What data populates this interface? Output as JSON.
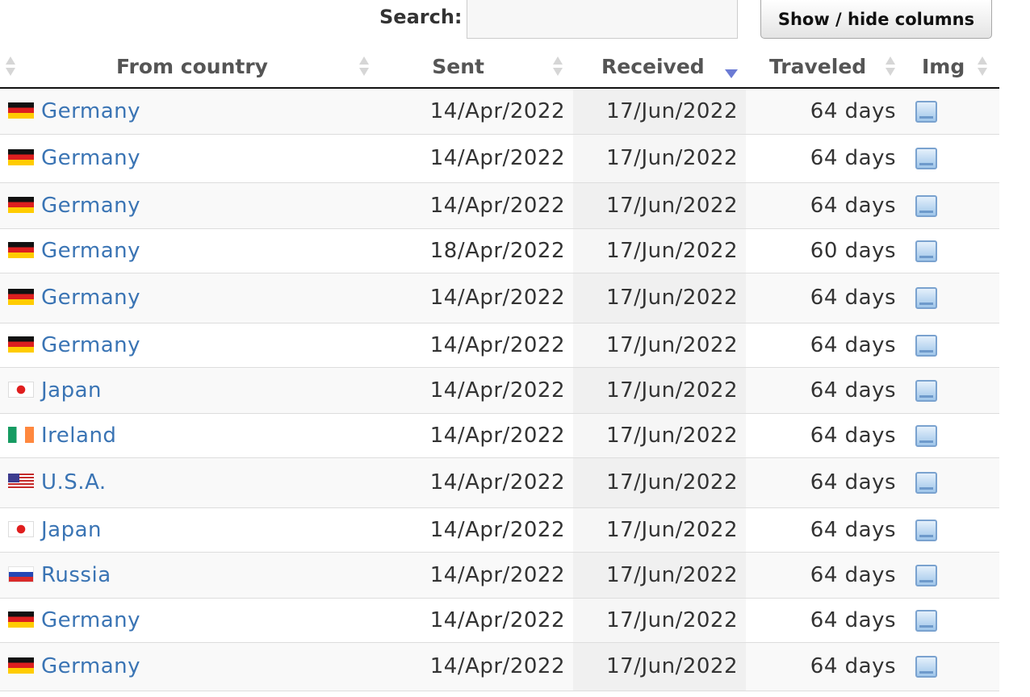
{
  "search": {
    "label": "Search:",
    "value": "",
    "placeholder": ""
  },
  "colvis_button": {
    "label": "Show / hide columns"
  },
  "columns": [
    {
      "key": "from_country",
      "label": "From country",
      "sort": "none"
    },
    {
      "key": "sent",
      "label": "Sent",
      "sort": "none"
    },
    {
      "key": "received",
      "label": "Received",
      "sort": "descending"
    },
    {
      "key": "traveled",
      "label": "Traveled",
      "sort": "none"
    },
    {
      "key": "img",
      "label": "Img",
      "sort": "none"
    }
  ],
  "rows": [
    {
      "country": "Germany",
      "flag": "de",
      "sent": "14/Apr/2022",
      "received": "17/Jun/2022",
      "traveled": "64 days",
      "img_icon": "image-icon"
    },
    {
      "country": "Germany",
      "flag": "de",
      "sent": "14/Apr/2022",
      "received": "17/Jun/2022",
      "traveled": "64 days",
      "img_icon": "image-icon"
    },
    {
      "country": "Germany",
      "flag": "de",
      "sent": "14/Apr/2022",
      "received": "17/Jun/2022",
      "traveled": "64 days",
      "img_icon": "image-icon"
    },
    {
      "country": "Germany",
      "flag": "de",
      "sent": "18/Apr/2022",
      "received": "17/Jun/2022",
      "traveled": "60 days",
      "img_icon": "image-icon"
    },
    {
      "country": "Germany",
      "flag": "de",
      "sent": "14/Apr/2022",
      "received": "17/Jun/2022",
      "traveled": "64 days",
      "img_icon": "image-icon"
    },
    {
      "country": "Germany",
      "flag": "de",
      "sent": "14/Apr/2022",
      "received": "17/Jun/2022",
      "traveled": "64 days",
      "img_icon": "image-icon"
    },
    {
      "country": "Japan",
      "flag": "jp",
      "sent": "14/Apr/2022",
      "received": "17/Jun/2022",
      "traveled": "64 days",
      "img_icon": "image-icon"
    },
    {
      "country": "Ireland",
      "flag": "ie",
      "sent": "14/Apr/2022",
      "received": "17/Jun/2022",
      "traveled": "64 days",
      "img_icon": "image-icon"
    },
    {
      "country": "U.S.A.",
      "flag": "us",
      "sent": "14/Apr/2022",
      "received": "17/Jun/2022",
      "traveled": "64 days",
      "img_icon": "image-icon"
    },
    {
      "country": "Japan",
      "flag": "jp",
      "sent": "14/Apr/2022",
      "received": "17/Jun/2022",
      "traveled": "64 days",
      "img_icon": "image-icon"
    },
    {
      "country": "Russia",
      "flag": "ru",
      "sent": "14/Apr/2022",
      "received": "17/Jun/2022",
      "traveled": "64 days",
      "img_icon": "image-icon"
    },
    {
      "country": "Germany",
      "flag": "de",
      "sent": "14/Apr/2022",
      "received": "17/Jun/2022",
      "traveled": "64 days",
      "img_icon": "image-icon"
    },
    {
      "country": "Germany",
      "flag": "de",
      "sent": "14/Apr/2022",
      "received": "17/Jun/2022",
      "traveled": "64 days",
      "img_icon": "image-icon"
    }
  ]
}
